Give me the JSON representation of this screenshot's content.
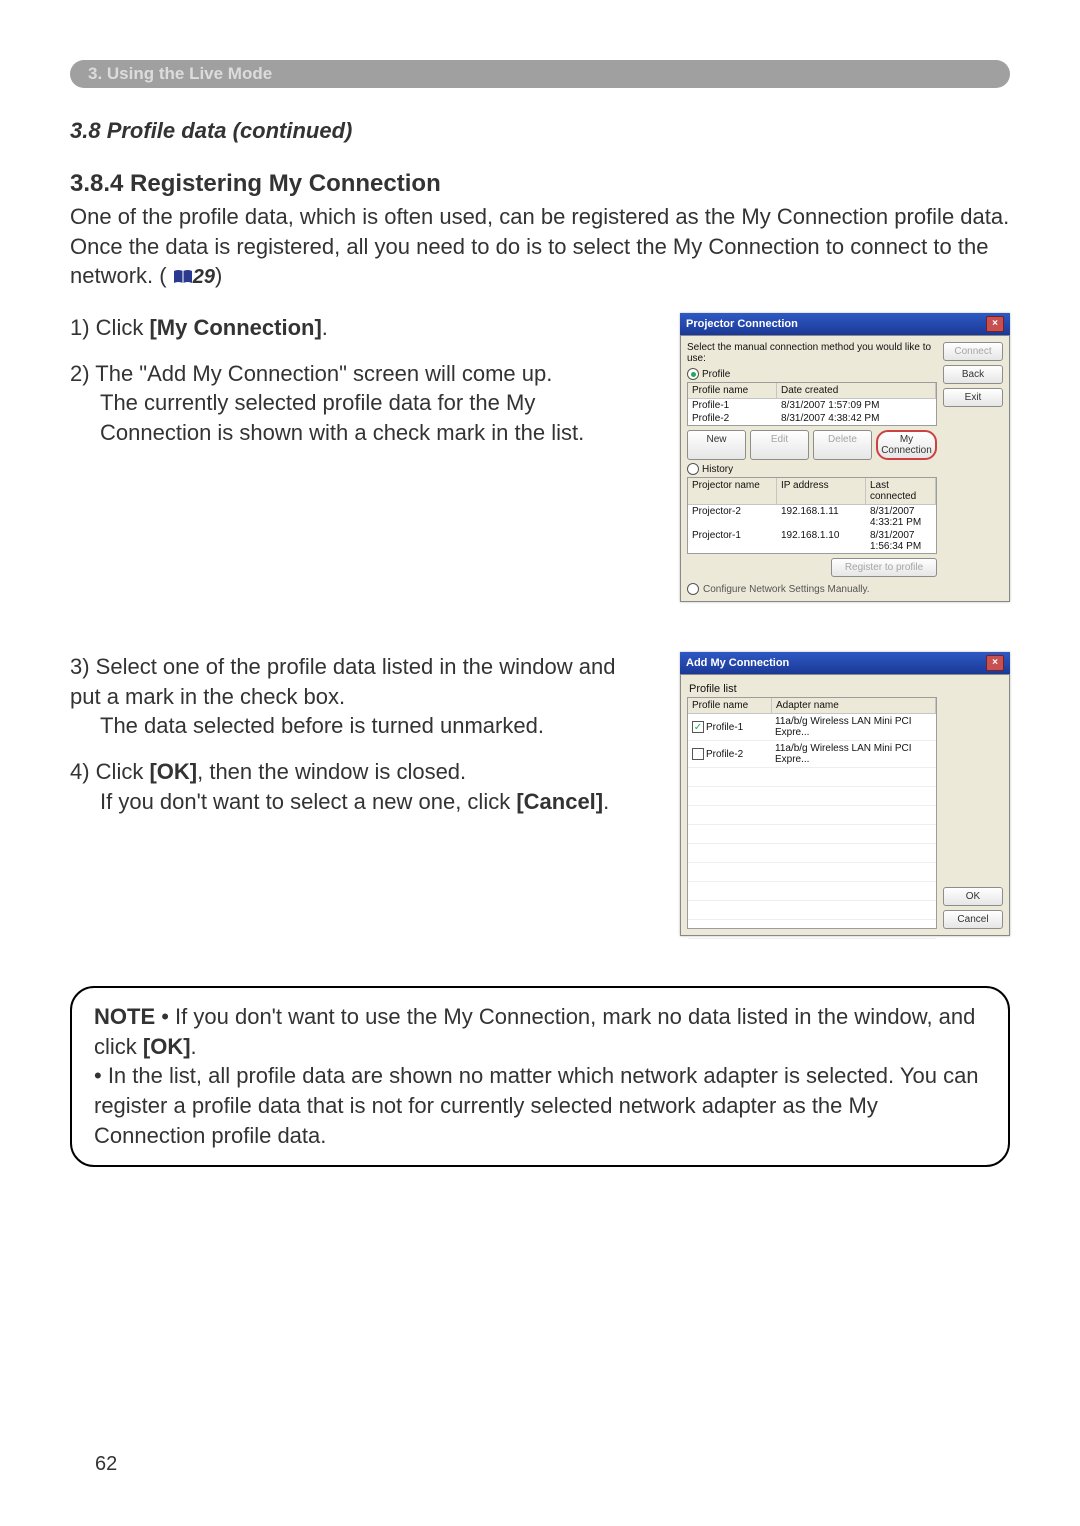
{
  "chapterBar": "3. Using the Live Mode",
  "sectionTitle": "3.8 Profile data (continued)",
  "subsectionTitle": "3.8.4 Registering My Connection",
  "intro": {
    "text_before_ref": "One of the profile data, which is often used, can be registered as the My Connection profile data. Once the data is registered, all you need to do is to select the My Connection to connect to the network. (",
    "ref": "29",
    "text_after_ref": ")"
  },
  "steps": {
    "s1_a": "1) Click ",
    "s1_bold": "[My Connection]",
    "s1_b": ".",
    "s2_a": "2) The \"Add My Connection\" screen will come up.",
    "s2_sub": "The currently selected profile data for the My Connection is shown with a check mark in the list.",
    "s3_a": "3) Select one of the profile data listed in the window and put a mark in the check box.",
    "s3_sub": "The data selected before is turned unmarked.",
    "s4_a": "4) Click ",
    "s4_bold1": "[OK]",
    "s4_b": ", then the window is closed.",
    "s4_sub_a": "If you don't want to select a new one, click ",
    "s4_bold2": "[Cancel]",
    "s4_sub_b": "."
  },
  "note": {
    "label": "NOTE",
    "p1_a": " • If you don't want to use the My Connection, mark no data listed in the window, and click ",
    "p1_bold": "[OK]",
    "p1_b": ".",
    "p2": "• In the list, all profile data are shown no matter which network adapter is selected. You can register a profile data that is not for currently selected network adapter as the My Connection profile data."
  },
  "dlg1": {
    "title": "Projector Connection",
    "instruction": "Select the manual connection method you would like to use:",
    "radio_profile": "Profile",
    "radio_history": "History",
    "profile_head_name": "Profile name",
    "profile_head_date": "Date created",
    "profiles": [
      {
        "name": "Profile-1",
        "date": "8/31/2007 1:57:09 PM"
      },
      {
        "name": "Profile-2",
        "date": "8/31/2007 4:38:42 PM"
      }
    ],
    "btn_new": "New",
    "btn_edit": "Edit",
    "btn_delete": "Delete",
    "btn_myconn": "My Connection",
    "hist_head_name": "Projector name",
    "hist_head_ip": "IP address",
    "hist_head_last": "Last connected",
    "history": [
      {
        "name": "Projector-2",
        "ip": "192.168.1.11",
        "last": "8/31/2007 4:33:21 PM"
      },
      {
        "name": "Projector-1",
        "ip": "192.168.1.10",
        "last": "8/31/2007 1:56:34 PM"
      }
    ],
    "btn_register": "Register to profile",
    "config_manual": "Configure Network Settings Manually.",
    "btn_connect": "Connect",
    "btn_back": "Back",
    "btn_exit": "Exit"
  },
  "dlg2": {
    "title": "Add My Connection",
    "list_label": "Profile list",
    "head_name": "Profile name",
    "head_adapter": "Adapter name",
    "items": [
      {
        "checked": true,
        "name": "Profile-1",
        "adapter": "11a/b/g Wireless LAN Mini PCI Expre..."
      },
      {
        "checked": false,
        "name": "Profile-2",
        "adapter": "11a/b/g Wireless LAN Mini PCI Expre..."
      }
    ],
    "btn_ok": "OK",
    "btn_cancel": "Cancel"
  },
  "pageNumber": "62"
}
